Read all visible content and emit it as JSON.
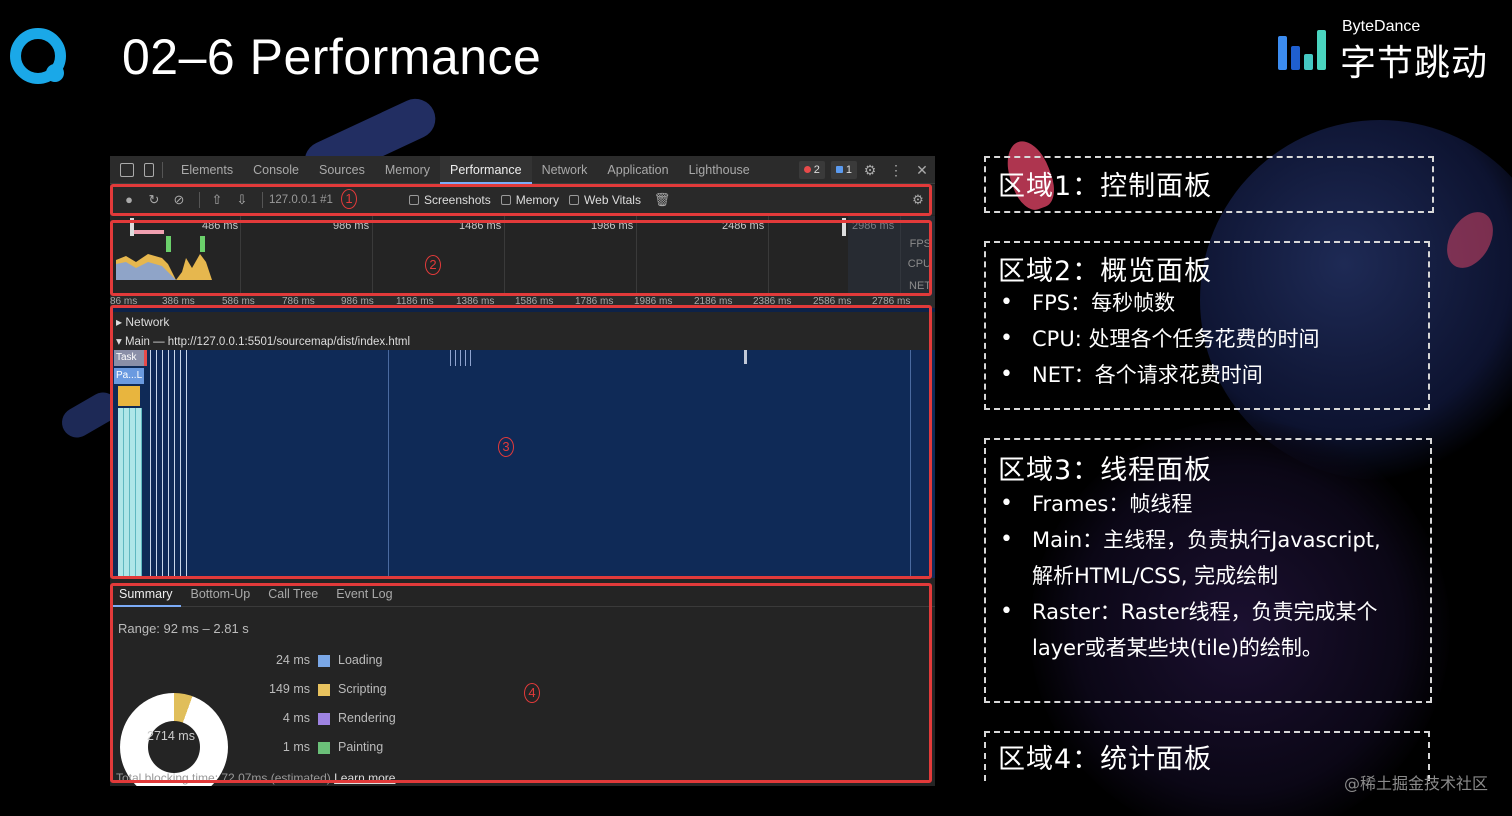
{
  "slide": {
    "title": "02–6 Performance",
    "brand_en": "ByteDance",
    "brand_cn": "字节跳动",
    "watermark": "@稀土掘金技术社区"
  },
  "devtools": {
    "tabs": [
      "Elements",
      "Console",
      "Sources",
      "Memory",
      "Performance",
      "Network",
      "Application",
      "Lighthouse"
    ],
    "active_tab": "Performance",
    "error_count": "2",
    "message_count": "1",
    "toolbar": {
      "profile": "127.0.0.1 #1",
      "screenshots": "Screenshots",
      "memory": "Memory",
      "web_vitals": "Web Vitals"
    },
    "overview_ticks": [
      "486 ms",
      "986 ms",
      "1486 ms",
      "1986 ms",
      "2486 ms",
      "2986 ms"
    ],
    "overview_labels": [
      "FPS",
      "CPU",
      "NET"
    ],
    "ruler_ticks": [
      "86 ms",
      "386 ms",
      "586 ms",
      "786 ms",
      "986 ms",
      "1186 ms",
      "1386 ms",
      "1586 ms",
      "1786 ms",
      "1986 ms",
      "2186 ms",
      "2386 ms",
      "2586 ms",
      "2786 ms"
    ],
    "threads": {
      "network": "Network",
      "main": "Main — http://127.0.0.1:5501/sourcemap/dist/index.html",
      "task": "Task",
      "pal": "Pa...L"
    },
    "summary": {
      "tabs": [
        "Summary",
        "Bottom-Up",
        "Call Tree",
        "Event Log"
      ],
      "active_tab": "Summary",
      "range": "Range: 92 ms – 2.81 s",
      "items": [
        {
          "ms": "24 ms",
          "label": "Loading",
          "color": "#7aa7e6"
        },
        {
          "ms": "149 ms",
          "label": "Scripting",
          "color": "#e8c25e"
        },
        {
          "ms": "4 ms",
          "label": "Rendering",
          "color": "#9e83e2"
        },
        {
          "ms": "1 ms",
          "label": "Painting",
          "color": "#6bc079"
        }
      ],
      "total": "2714 ms",
      "blocking": "Total blocking time: 72.07ms (estimated)",
      "learn_more": "Learn more"
    }
  },
  "markers": [
    "1",
    "2",
    "3",
    "4"
  ],
  "panels": [
    {
      "title": "区域1：控制面板",
      "items": []
    },
    {
      "title": "区域2：概览面板",
      "items": [
        {
          "text": "FPS：每秒帧数"
        },
        {
          "text": "CPU: 处理各个任务花费的时间"
        },
        {
          "text": "NET：各个请求花费时间"
        }
      ]
    },
    {
      "title": "区域3：线程面板",
      "items": [
        {
          "text": "Frames：帧线程"
        },
        {
          "text": "Main：主线程，负责执行Javascript,",
          "cont": "解析HTML/CSS, 完成绘制"
        },
        {
          "text": "Raster：Raster线程，负责完成某个",
          "cont": "layer或者某些块(tile)的绘制。"
        }
      ]
    },
    {
      "title": "区域4：统计面板",
      "items": []
    }
  ]
}
